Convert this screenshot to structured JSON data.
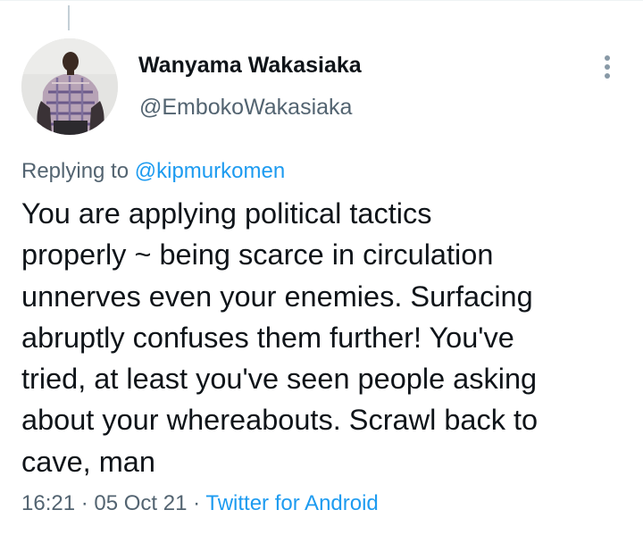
{
  "author": {
    "display_name": "Wanyama Wakasiaka",
    "handle": "@EmbokoWakasiaka"
  },
  "reply": {
    "prefix": "Replying to ",
    "mention": "@kipmurkomen"
  },
  "tweet": {
    "lines": [
      "You are applying political tactics",
      "properly ~ being scarce in circulation",
      "unnerves even your enemies. Surfacing",
      "abruptly confuses them further! You've",
      "tried, at least you've seen people asking",
      "about your whereabouts. Scrawl back to",
      "cave, man"
    ]
  },
  "meta": {
    "time": "16:21",
    "separator_1": " · ",
    "date": "05 Oct 21",
    "separator_2": " · ",
    "source": "Twitter for Android"
  },
  "icons": {
    "more": "more-vertical-icon",
    "avatar": "profile-photo"
  },
  "colors": {
    "text_primary": "#0f1419",
    "text_secondary": "#536471",
    "link": "#1d9bf0",
    "background": "#ffffff"
  }
}
